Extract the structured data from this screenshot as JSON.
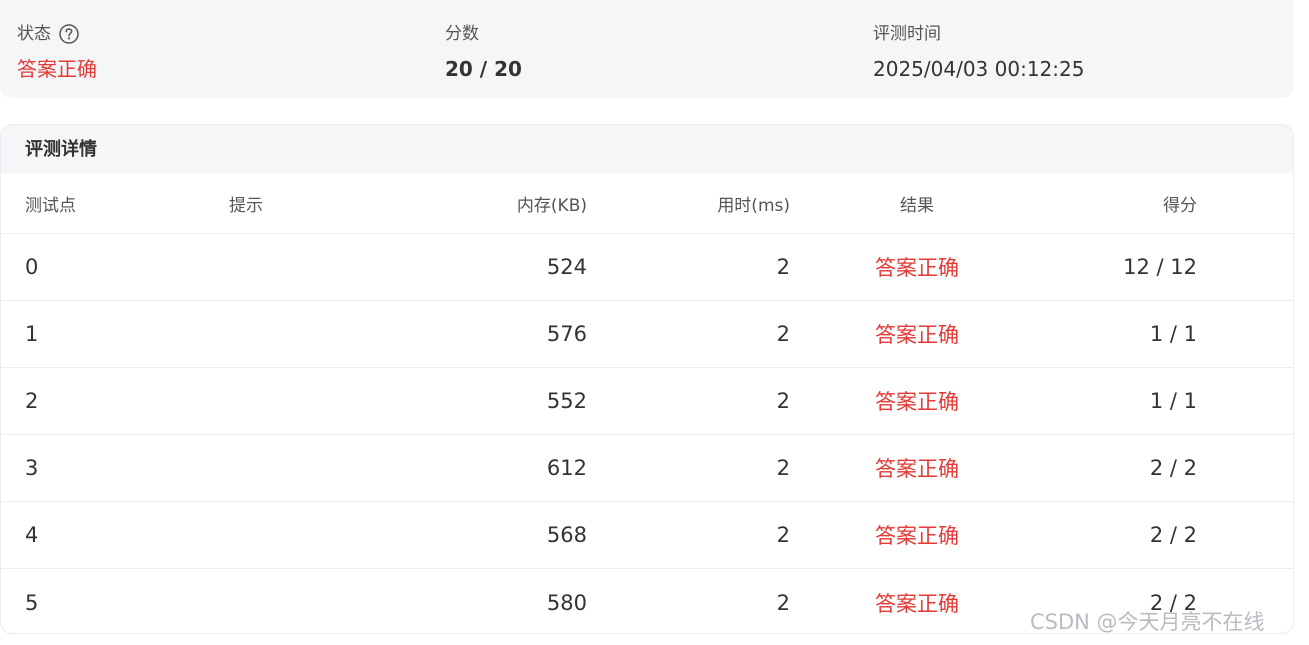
{
  "summary": {
    "status_label": "状态",
    "status_value": "答案正确",
    "score_label": "分数",
    "score_value": "20 / 20",
    "time_label": "评测时间",
    "time_value": "2025/04/03 00:12:25"
  },
  "detail": {
    "title": "评测详情",
    "columns": {
      "id": "测试点",
      "hint": "提示",
      "memory": "内存(KB)",
      "time": "用时(ms)",
      "result": "结果",
      "score": "得分"
    },
    "rows": [
      {
        "id": "0",
        "hint": "",
        "memory": "524",
        "time": "2",
        "result": "答案正确",
        "score": "12 / 12"
      },
      {
        "id": "1",
        "hint": "",
        "memory": "576",
        "time": "2",
        "result": "答案正确",
        "score": "1 / 1"
      },
      {
        "id": "2",
        "hint": "",
        "memory": "552",
        "time": "2",
        "result": "答案正确",
        "score": "1 / 1"
      },
      {
        "id": "3",
        "hint": "",
        "memory": "612",
        "time": "2",
        "result": "答案正确",
        "score": "2 / 2"
      },
      {
        "id": "4",
        "hint": "",
        "memory": "568",
        "time": "2",
        "result": "答案正确",
        "score": "2 / 2"
      },
      {
        "id": "5",
        "hint": "",
        "memory": "580",
        "time": "2",
        "result": "答案正确",
        "score": "2 / 2"
      }
    ]
  },
  "watermark": "CSDN @今天月亮不在线",
  "colors": {
    "accepted": "#e53935",
    "card_bg": "#f5f6f8",
    "border": "#ebedf0"
  },
  "icons": {
    "status_help": "question-circle-icon"
  }
}
